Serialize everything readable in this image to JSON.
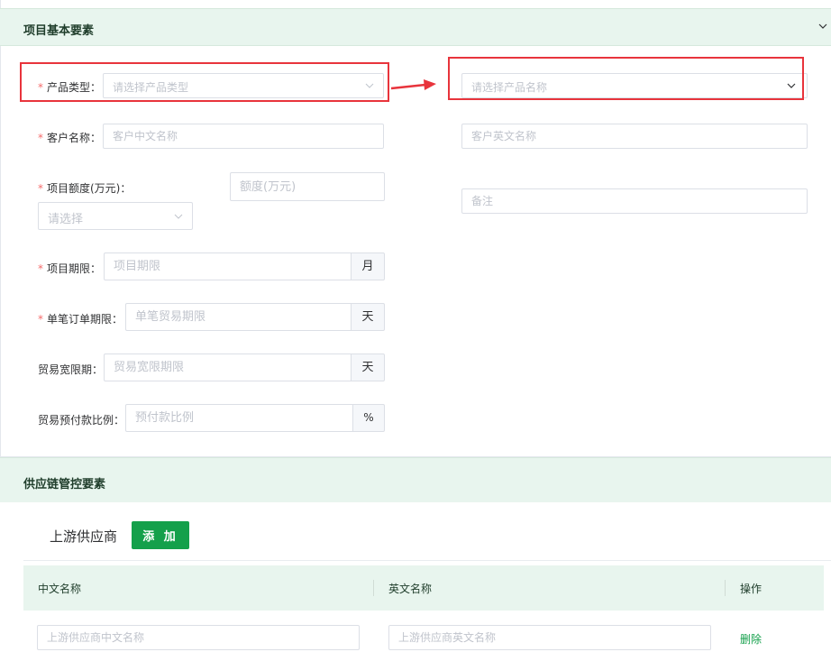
{
  "basic_section": {
    "title": "项目基本要素"
  },
  "required_mark": "*",
  "fields": {
    "product_type": {
      "label": "产品类型：",
      "placeholder": "请选择产品类型"
    },
    "product_name": {
      "placeholder": "请选择产品名称"
    },
    "customer_name": {
      "label": "客户名称：",
      "placeholder": "客户中文名称"
    },
    "customer_english_name": {
      "placeholder": "客户英文名称"
    },
    "project_amount": {
      "label": "项目额度(万元)：",
      "amount_placeholder": "额度(万元)",
      "select_placeholder": "请选择"
    },
    "remarks": {
      "placeholder": "备注"
    },
    "project_term": {
      "label": "项目期限：",
      "placeholder": "项目期限",
      "unit": "月"
    },
    "single_order_term": {
      "label": "单笔订单期限：",
      "placeholder": "单笔贸易期限",
      "unit": "天"
    },
    "trade_grace_period": {
      "label": "贸易宽限期：",
      "placeholder": "贸易宽限期限",
      "unit": "天"
    },
    "trade_prepayment_ratio": {
      "label": "贸易预付款比例：",
      "placeholder": "预付款比例",
      "unit": "%"
    }
  },
  "supply_section": {
    "title": "供应链管控要素",
    "upstream_title": "上游供应商",
    "add_button": "添 加",
    "table": {
      "columns": [
        "中文名称",
        "英文名称",
        "操作"
      ],
      "rows": [
        {
          "chinese_placeholder": "上游供应商中文名称",
          "english_placeholder": "上游供应商英文名称",
          "action": "删除"
        }
      ]
    }
  },
  "colors": {
    "accent_green": "#14a04b",
    "header_bg": "#e8f5ee",
    "required_red": "#f56c6c",
    "annotation_red": "#e8343c"
  },
  "icons": {
    "collapse": "chevron-down-icon",
    "select_arrow": "chevron-down-icon",
    "annotation": "arrow-right-icon"
  }
}
